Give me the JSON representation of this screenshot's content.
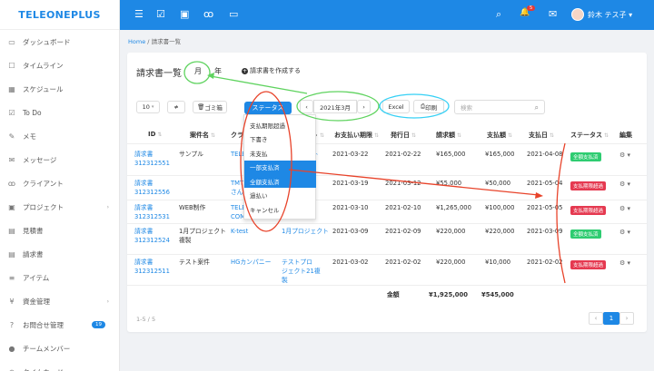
{
  "brand": {
    "logo_text": "TELEONEPLUS"
  },
  "sidebar": {
    "items": [
      {
        "label": "ダッシュボード",
        "icon": "monitor-icon",
        "glyph": "▭",
        "chevron": false,
        "badge": ""
      },
      {
        "label": "タイムライン",
        "icon": "square-icon",
        "glyph": "☐",
        "chevron": false,
        "badge": ""
      },
      {
        "label": "スケジュール",
        "icon": "calendar-icon",
        "glyph": "▦",
        "chevron": false,
        "badge": ""
      },
      {
        "label": "To Do",
        "icon": "checkbox-icon",
        "glyph": "☑",
        "chevron": false,
        "badge": ""
      },
      {
        "label": "メモ",
        "icon": "memo-icon",
        "glyph": "✎",
        "chevron": false,
        "badge": ""
      },
      {
        "label": "メッセージ",
        "icon": "mail-icon",
        "glyph": "✉",
        "chevron": false,
        "badge": ""
      },
      {
        "label": "クライアント",
        "icon": "people-icon",
        "glyph": "ꝏ",
        "chevron": false,
        "badge": ""
      },
      {
        "label": "プロジェクト",
        "icon": "briefcase-icon",
        "glyph": "▣",
        "chevron": true,
        "badge": ""
      },
      {
        "label": "見積書",
        "icon": "document-icon",
        "glyph": "▤",
        "chevron": false,
        "badge": ""
      },
      {
        "label": "請求書",
        "icon": "invoice-icon",
        "glyph": "▤",
        "chevron": false,
        "badge": ""
      },
      {
        "label": "アイテム",
        "icon": "list-icon",
        "glyph": "≡",
        "chevron": false,
        "badge": ""
      },
      {
        "label": "資金管理",
        "icon": "yen-icon",
        "glyph": "¥",
        "chevron": true,
        "badge": ""
      },
      {
        "label": "お問合せ管理",
        "icon": "question-icon",
        "glyph": "?",
        "chevron": false,
        "badge": "19"
      },
      {
        "label": "チームメンバー",
        "icon": "user-icon",
        "glyph": "●",
        "chevron": false,
        "badge": ""
      },
      {
        "label": "タイムカード",
        "icon": "clock-icon",
        "glyph": "◷",
        "chevron": false,
        "badge": ""
      }
    ]
  },
  "topbar": {
    "icons": [
      {
        "name": "menu-icon",
        "glyph": "☰"
      },
      {
        "name": "checkbox-icon",
        "glyph": "☑"
      },
      {
        "name": "briefcase-icon",
        "glyph": "▣"
      },
      {
        "name": "people-icon",
        "glyph": "ꝏ"
      },
      {
        "name": "monitor-icon",
        "glyph": "▭"
      }
    ],
    "search_glyph": "⌕",
    "bell_glyph": "🔔",
    "notif_count": "5",
    "mail_glyph": "✉",
    "user_name": "鈴木 テス子 ▾"
  },
  "breadcrumb": {
    "home": "Home",
    "sep": "/",
    "current": "請求書一覧"
  },
  "page": {
    "title": "請求書一覧",
    "tab_month": "月",
    "tab_year": "年",
    "create_label": "請求書を作成する"
  },
  "toolbar": {
    "page_size": "10",
    "trash_label": "ゴミ箱",
    "status_label": "ステータス",
    "period_label": "2021年3月",
    "prev_glyph": "‹",
    "next_glyph": "›",
    "excel_label": "Excel",
    "print_label": "印刷",
    "search_placeholder": "検索"
  },
  "status_options": [
    "支払期限超過",
    "下書き",
    "未支払",
    "一部支払済",
    "全額支払済",
    "過払い",
    "キャンセル"
  ],
  "status_selected": [
    3,
    4
  ],
  "table": {
    "headers": [
      "ID",
      "案件名",
      "クライアント",
      "プロジェクト",
      "お支払い期限",
      "発行日",
      "請求額",
      "支払額",
      "支払日",
      "ステータス",
      "編集"
    ],
    "rows": [
      {
        "id": "請求書\n312312551",
        "case": "サンプル",
        "client": "TELEONEPLUS CO",
        "project": "プロジェクト",
        "due": "2021-03-22",
        "issued": "2021-02-22",
        "amount": "¥165,000",
        "paid": "¥165,000",
        "paid_date": "2021-04-08",
        "status": "全額支払済"
      },
      {
        "id": "請求書\n312312556",
        "case": "",
        "client": "TMT\nさんに",
        "project": "",
        "due": "2021-03-19",
        "issued": "2021-03-12",
        "amount": "¥55,000",
        "paid": "¥50,000",
        "paid_date": "2021-05-04",
        "status": "支払期限超過"
      },
      {
        "id": "請求書\n312312531",
        "case": "WEB制作",
        "client": "TELE\nCOM",
        "project": "",
        "due": "2021-03-10",
        "issued": "2021-02-10",
        "amount": "¥1,265,000",
        "paid": "¥100,000",
        "paid_date": "2021-05-05",
        "status": "支払期限超過"
      },
      {
        "id": "請求書\n312312524",
        "case": "1月プロジェクト\n複製",
        "client": "K-test",
        "project": "1月プロジェクト",
        "due": "2021-03-09",
        "issued": "2021-02-09",
        "amount": "¥220,000",
        "paid": "¥220,000",
        "paid_date": "2021-03-09",
        "status": "全額支払済"
      },
      {
        "id": "請求書\n312312511",
        "case": "テスト案件",
        "client": "HGカンパニー",
        "project": "テストプロ\nジェクト21複\n製",
        "due": "2021-03-02",
        "issued": "2021-02-02",
        "amount": "¥220,000",
        "paid": "¥10,000",
        "paid_date": "2021-02-02",
        "status": "支払期限超過"
      }
    ],
    "total_label": "金額",
    "total_amount": "¥1,925,000",
    "total_paid": "¥545,000",
    "edit_glyph": "⚙ ▾"
  },
  "footer": {
    "count": "1-5 / 5",
    "prev": "‹",
    "page": "1",
    "next": "›"
  },
  "colors": {
    "primary": "#1e88e5",
    "paid": "#2ecc71",
    "overdue": "#e53950",
    "annot_green": "#5fd35f",
    "annot_red": "#e8432a",
    "annot_cyan": "#35d0f5"
  }
}
